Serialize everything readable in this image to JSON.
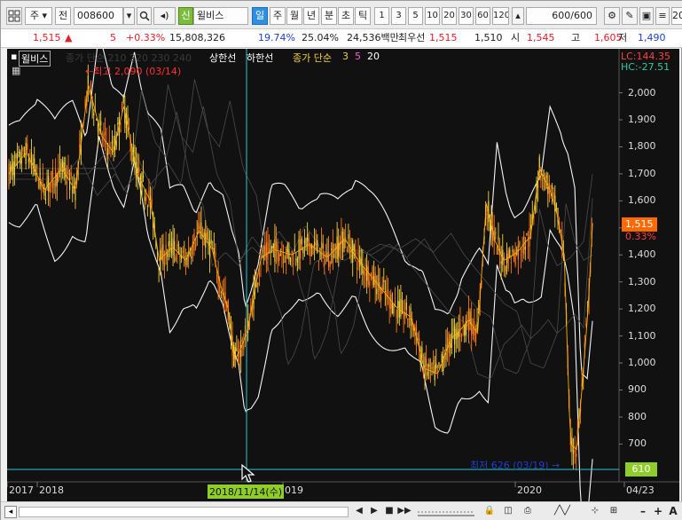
{
  "toolbar": {
    "period_tab": "주",
    "market": "전",
    "code": "008600",
    "badge": "신",
    "stock_name": "윌비스",
    "tabs": [
      "일",
      "주",
      "월",
      "년",
      "분",
      "초",
      "틱"
    ],
    "selected_tab": "일",
    "numbers": [
      "1",
      "3",
      "5",
      "10",
      "20",
      "30",
      "60",
      "120"
    ],
    "count": "600",
    "count_max": "/600",
    "edge_label": "20"
  },
  "quote": {
    "price": "1,515",
    "change": "5",
    "change_pct": "+0.33%",
    "volume": "15,808,326",
    "turnover_pct": "19.74%",
    "ratio_pct": "25.04%",
    "amount": "24,536백만",
    "priority_label": "최우선",
    "ask": "1,515",
    "bid": "1,510",
    "open_label": "시",
    "open": "1,545",
    "high_label": "고",
    "high": "1,605",
    "low_label": "저",
    "low": "1,490"
  },
  "chart_data": {
    "type": "line",
    "title": "윌비스",
    "legend": [
      "상한선",
      "하한선",
      "종가 단순",
      "3",
      "5",
      "20"
    ],
    "faded_legend": "종가 단순 210  220  230  240",
    "high_marker": "최고 2,090 (03/14)",
    "low_marker": "최저 626 (03/19)",
    "crosshair_date": "2018/11/14(수)",
    "crosshair_value": "610",
    "lc": "LC:144.35",
    "hc": "HC:-27.51",
    "last_price": "1,515",
    "last_change": "0.33%",
    "y_ticks": [
      "2,000",
      "1,900",
      "1,800",
      "1,700",
      "1,600",
      "1,500",
      "1,400",
      "1,300",
      "1,200",
      "1,100",
      "1,000",
      "900",
      "800",
      "700"
    ],
    "x_ticks": [
      "2017",
      "2018",
      "019",
      "2020",
      "04/23"
    ],
    "ylim": [
      560,
      2130
    ],
    "x_range": [
      0,
      690
    ],
    "series": [
      {
        "name": "종가",
        "x": [
          0,
          20,
          40,
          60,
          75,
          90,
          105,
          118,
          130,
          145,
          160,
          170,
          185,
          200,
          215,
          230,
          240,
          248,
          255,
          262,
          270,
          285,
          300,
          320,
          340,
          360,
          380,
          395,
          410,
          425,
          440,
          455,
          470,
          485,
          500,
          510,
          520,
          530,
          540,
          550,
          560,
          575,
          590,
          600,
          612,
          620,
          628,
          635,
          642,
          648,
          655,
          660
        ],
        "values": [
          1700,
          1780,
          1640,
          1720,
          1640,
          2030,
          1840,
          1780,
          1950,
          1700,
          1600,
          1380,
          1430,
          1380,
          1490,
          1420,
          1280,
          1200,
          1010,
          1050,
          1120,
          1390,
          1420,
          1400,
          1440,
          1390,
          1460,
          1380,
          1320,
          1260,
          1200,
          1170,
          980,
          960,
          1090,
          1120,
          1160,
          1110,
          1590,
          1450,
          1380,
          1410,
          1470,
          1720,
          1640,
          1550,
          1400,
          700,
          680,
          900,
          1200,
          1515
        ]
      }
    ]
  },
  "bottom": {
    "nav_buttons": [
      "◀",
      "▶",
      "■",
      "▶▶"
    ],
    "right_buttons": [
      "–",
      "+",
      "A"
    ]
  }
}
